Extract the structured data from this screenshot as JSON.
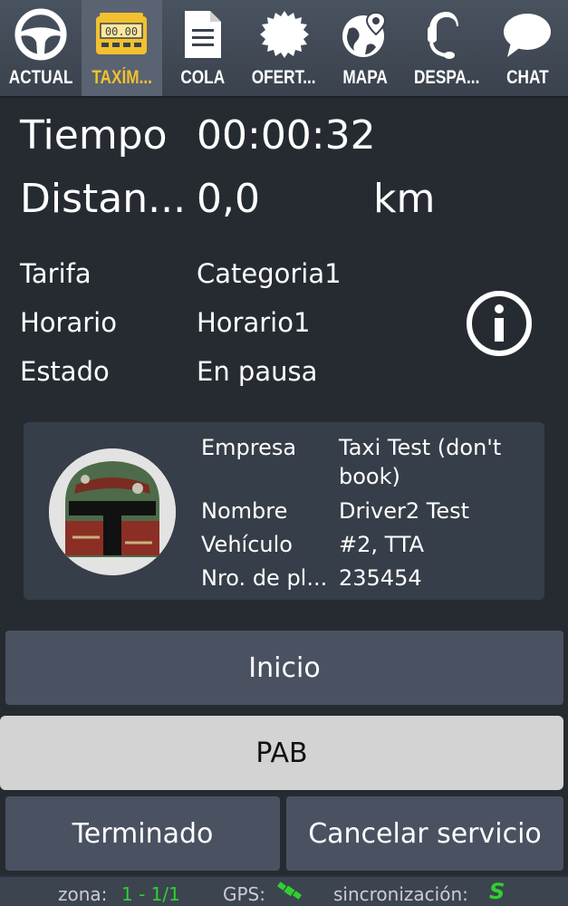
{
  "tabs": [
    {
      "label": "ACTUAL",
      "icon": "steering-wheel-icon"
    },
    {
      "label": "TAXÍM...",
      "icon": "taximeter-icon",
      "active": true
    },
    {
      "label": "COLA",
      "icon": "document-icon"
    },
    {
      "label": "OFERT...",
      "icon": "badge-icon"
    },
    {
      "label": "MAPA",
      "icon": "globe-pin-icon"
    },
    {
      "label": "DESPA...",
      "icon": "headset-icon"
    },
    {
      "label": "CHAT",
      "icon": "chat-bubble-icon"
    }
  ],
  "taximeter_display": "00.00",
  "meter": {
    "time_label": "Tiempo",
    "time_value": "00:00:32",
    "distance_label": "Distan...",
    "distance_value": "0,0",
    "distance_unit": "km"
  },
  "details": {
    "tarifa_label": "Tarifa",
    "tarifa_value": "Categoria1",
    "horario_label": "Horario",
    "horario_value": "Horario1",
    "estado_label": "Estado",
    "estado_value": "En pausa"
  },
  "driver": {
    "empresa_label": "Empresa",
    "empresa_value": "Taxi Test (don't book)",
    "nombre_label": "Nombre",
    "nombre_value": "Driver2 Test",
    "vehiculo_label": "Vehículo",
    "vehiculo_value": "#2, TTA",
    "placa_label": "Nro. de pl...",
    "placa_value": "235454"
  },
  "buttons": {
    "inicio": "Inicio",
    "pab": "PAB",
    "terminado": "Terminado",
    "cancelar": "Cancelar servicio"
  },
  "status": {
    "zona_label": "zona:",
    "zona_value": "1 - 1/1",
    "gps_label": "GPS:",
    "sync_label": "sincronización:",
    "sync_value": "S"
  },
  "colors": {
    "active_tab": "#f2c12e",
    "background": "#262b32",
    "status_ok": "#2fd12f"
  }
}
